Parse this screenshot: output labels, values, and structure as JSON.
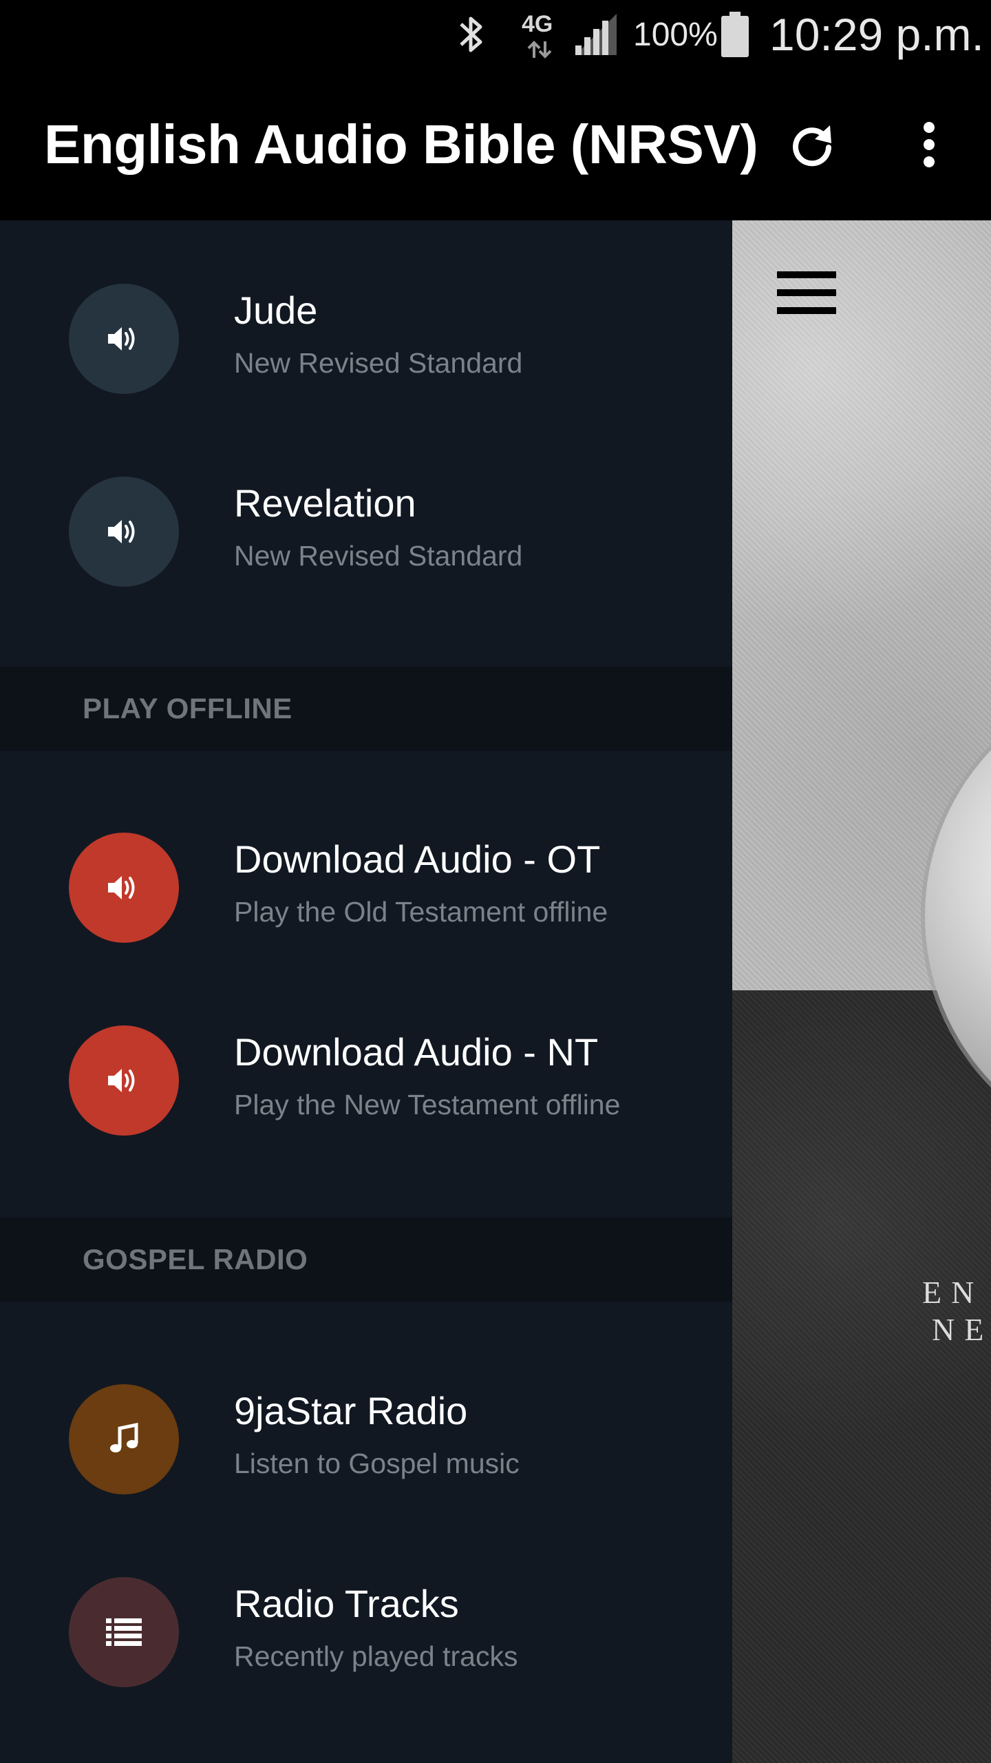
{
  "status_bar": {
    "network": "4G",
    "battery_percent": "100%",
    "time": "10:29 p.m."
  },
  "app_bar": {
    "title": "English Audio Bible (NRSV)"
  },
  "drawer": {
    "books": [
      {
        "title": "Jude",
        "subtitle": "New Revised Standard",
        "icon": "speaker-icon",
        "color": "#263440"
      },
      {
        "title": "Revelation",
        "subtitle": "New Revised Standard",
        "icon": "speaker-icon",
        "color": "#263440"
      }
    ],
    "play_offline_header": "PLAY OFFLINE",
    "offline_items": [
      {
        "title": "Download Audio - OT",
        "subtitle": "Play the Old Testament offline",
        "icon": "speaker-icon",
        "color": "#c0392b"
      },
      {
        "title": "Download Audio - NT",
        "subtitle": "Play the New Testament offline",
        "icon": "speaker-icon",
        "color": "#c0392b"
      }
    ],
    "gospel_radio_header": "GOSPEL RADIO",
    "radio_items": [
      {
        "title": "9jaStar Radio",
        "subtitle": "Listen to Gospel music",
        "icon": "music-note-icon",
        "color": "#6b3d10"
      },
      {
        "title": "Radio Tracks",
        "subtitle": "Recently played tracks",
        "icon": "list-icon",
        "color": "#4a2c30"
      }
    ]
  },
  "background": {
    "text_line_1": "EN",
    "text_line_2": "NE"
  }
}
